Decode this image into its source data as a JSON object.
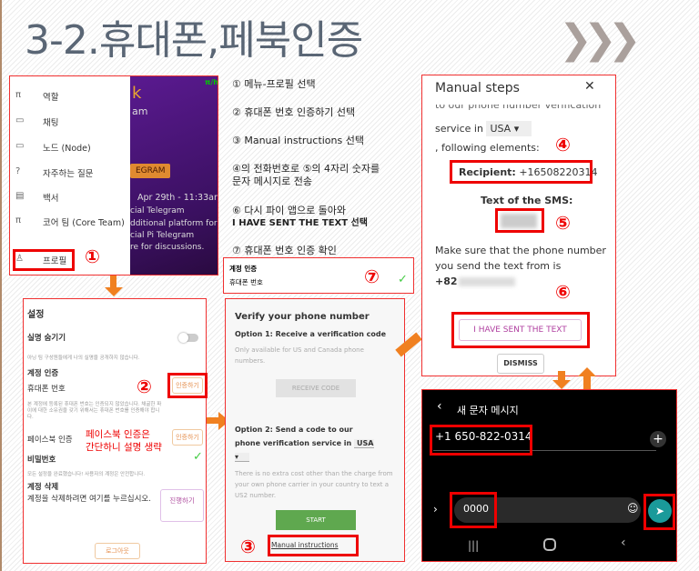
{
  "title": "3-2.휴대폰,페북인증",
  "chevron": "❯❯❯",
  "markers": [
    "①",
    "②",
    "③",
    "④",
    "⑤",
    "⑥",
    "⑦"
  ],
  "menu": {
    "items": [
      {
        "icon": "pi-icon",
        "glyph": "π",
        "label": "역할"
      },
      {
        "icon": "chat-icon",
        "glyph": "▭",
        "label": "채팅"
      },
      {
        "icon": "laptop-icon",
        "glyph": "▭",
        "label": "노드 (Node)"
      },
      {
        "icon": "help-icon",
        "glyph": "?",
        "label": "자주하는 질문"
      },
      {
        "icon": "document-icon",
        "glyph": "▤",
        "label": "백서"
      },
      {
        "icon": "pi-coin-icon",
        "glyph": "π",
        "label": "코어 팀 (Core Team)"
      },
      {
        "icon": "person-icon",
        "glyph": "♙",
        "label": "프로필"
      }
    ],
    "background": {
      "badge": "π/h",
      "k": "k",
      "am": "am",
      "button": "EGRAM",
      "date": "Apr 29th - 11:33am",
      "lines": [
        "cial Telegram",
        "dditional platform for",
        "cial Pi Telegram",
        "re for discussions."
      ]
    }
  },
  "settings": {
    "header": "설정",
    "hide_name": "실명 숨기기",
    "hide_name_desc": "아닝 팀 구성원들에게 나의 실명을 공개하지 않습니다.",
    "account_verify": "계정 인증",
    "phone": "휴대폰 번호",
    "verify_btn": "인증하기",
    "phone_desc": "본 계정에 등록된 휴대폰 번호는 인증되지 않았습니다. 채굴한 파이에 대한 소유권을 갖기 위해서는 휴대폰 번호를 인증해야 합니다.",
    "facebook": "페이스북 인증",
    "facebook_btn": "인증하기",
    "note_line1": "페이스북 인증은",
    "note_line2": "간단하니 설명 생략",
    "password": "비밀번호",
    "password_desc": "모든 설정을 완료했습니다! 사용자의 계정은 안전합니다.",
    "delete": "계정 삭제",
    "delete_desc": "계정을 삭제하려면 여기를 누르십시오.",
    "proceed_btn": "진행하기",
    "logout_btn": "로그아웃"
  },
  "verify": {
    "heading": "Verify your phone number",
    "option1": "Option 1: Receive a verification code",
    "option1_desc": "Only available for US and Canada phone numbers.",
    "receive_btn": "RECEIVE CODE",
    "option2": "Option 2: Send a code to our phone verification service in",
    "country": "USA",
    "cost_desc": "There is no extra cost other than the charge from your own phone carrier in your country to text a US2 number.",
    "start_btn": "START",
    "manual_link": "Manual instructions"
  },
  "instructions": [
    "① 메뉴-프로필 선택",
    "② 휴대폰 번호 인증하기 선택",
    "③ Manual instructions 선택",
    "④의 전화번호로 ⑤의 4자리 숫자를",
    "문자 메시지로 전송",
    "⑥ 다시 파이 앱으로 돌아와",
    "I HAVE SENT THE TEXT 선택",
    "⑦ 휴대폰 번호 인증 확인"
  ],
  "confirm": {
    "label": "계정 인증",
    "phone": "휴대폰 번호",
    "check": "✓"
  },
  "manual": {
    "title": "Manual steps",
    "close": "✕",
    "cut_line": "to our phone number verification",
    "service_in": "service in",
    "country": "USA",
    "following": ", following elements:",
    "recipient_label": "Recipient:",
    "recipient": "+16508220314",
    "sms_label": "Text of the SMS:",
    "make_sure": "Make sure that the phone number you send the text from is",
    "prefix": "+82",
    "sent_btn": "I HAVE SENT THE TEXT",
    "dismiss_btn": "DISMISS"
  },
  "sms": {
    "title": "새 문자 메시지",
    "recipient": "+1 650-822-0314",
    "message": "0000"
  },
  "colors": {
    "accent": "#e00000",
    "arrow": "#f08020",
    "title": "#5a6675",
    "start": "#5fa84f",
    "send": "#1a9a9a",
    "sent_btn": "#b040a0"
  }
}
